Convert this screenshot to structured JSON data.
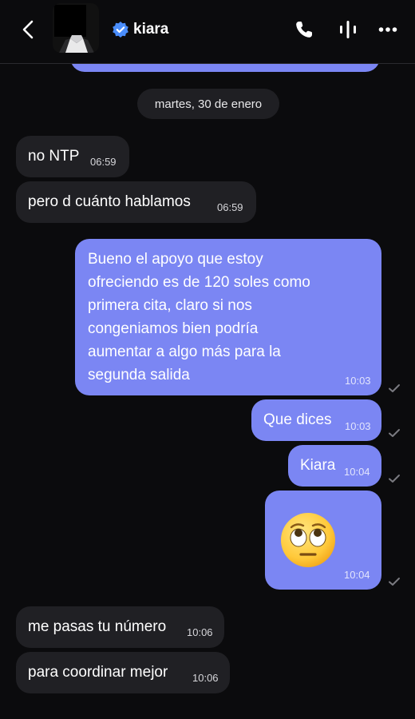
{
  "contact": {
    "name": "kiara"
  },
  "date_separator": "martes, 30 de enero",
  "messages": [
    {
      "direction": "in",
      "text": "no NTP",
      "time": "06:59"
    },
    {
      "direction": "in",
      "text": "pero d cuánto hablamos",
      "time": "06:59"
    },
    {
      "direction": "out",
      "lines": [
        "Bueno el apoyo que estoy",
        "ofreciendo es de 120 soles como",
        "primera cita, claro si nos",
        "congeniamos bien podría",
        "aumentar a algo más para la",
        "segunda salida"
      ],
      "time": "10:03",
      "status": "sent"
    },
    {
      "direction": "out",
      "text": "Que dices",
      "time": "10:03",
      "status": "sent"
    },
    {
      "direction": "out",
      "text": "Kiara",
      "time": "10:04",
      "status": "sent"
    },
    {
      "direction": "out",
      "emoji": "face-with-rolling-eyes",
      "time": "10:04",
      "status": "sent"
    },
    {
      "direction": "in",
      "text": "me pasas tu número",
      "time": "10:06"
    },
    {
      "direction": "in",
      "text": "para coordinar mejor",
      "time": "10:06"
    }
  ],
  "icons": {
    "back": "chevron-left-icon",
    "verified": "verified-badge-icon",
    "call": "phone-icon",
    "voice": "audio-bars-icon",
    "more": "more-dots-icon",
    "read": "check-icon"
  },
  "colors": {
    "outgoing_bubble": "#7b86f3",
    "incoming_bubble": "#202024",
    "background": "#0b0b0d",
    "verified": "#4a8dfb"
  }
}
